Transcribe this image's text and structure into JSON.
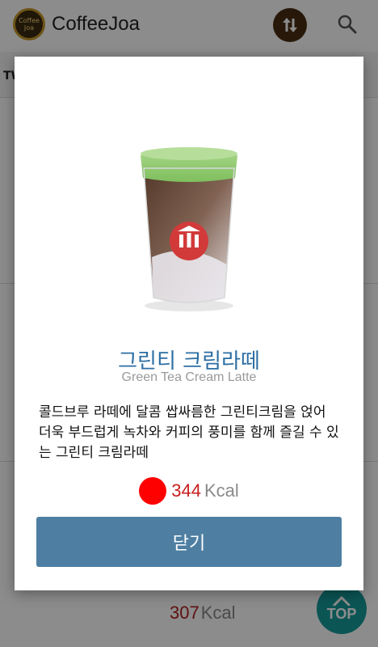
{
  "app": {
    "title": "CoffeeJoa",
    "logo_text": "Coffee Joa",
    "tab_fragment": "TW"
  },
  "icons": {
    "sort": "swap-vertical-icon",
    "search": "search-icon",
    "top": "arrow-up-icon"
  },
  "background_item": {
    "kcal_value": "307",
    "kcal_unit": "Kcal"
  },
  "top_button": {
    "label": "TOP"
  },
  "dialog": {
    "name_ko": "그린티 크림라떼",
    "name_en": "Green Tea Cream Latte",
    "description": "콜드브루 라떼에 달콤 쌉싸름한 그린티크림을 얹어 더욱 부드럽게 녹차와 커피의 풍미를 함께 즐길 수 있는 그린티 크림라떼",
    "kcal_value": "344",
    "kcal_unit": "Kcal",
    "close_label": "닫기"
  },
  "colors": {
    "accent_button": "#4e7fa2",
    "title_blue": "#2d6ea3",
    "kcal_red": "#ff0000",
    "top_button_teal": "#169c9c",
    "sort_button_brown": "#4a2d12"
  }
}
